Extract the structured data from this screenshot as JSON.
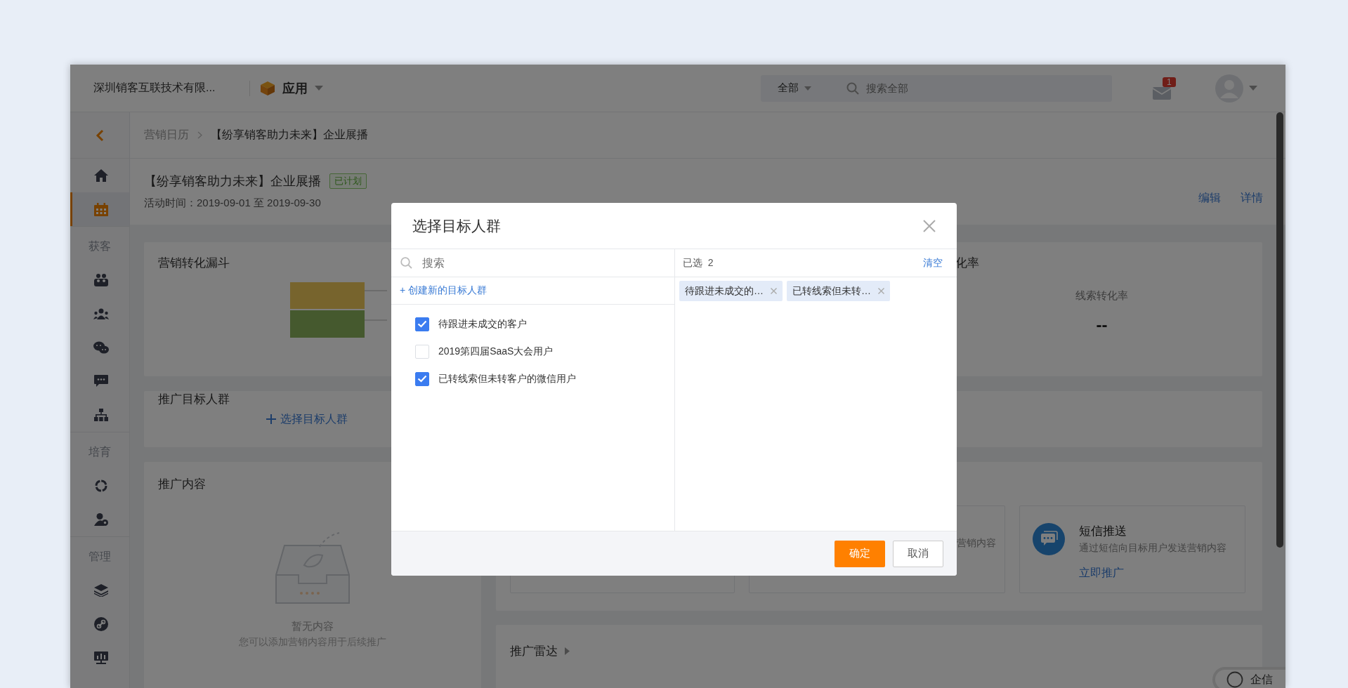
{
  "topbar": {
    "company": "深圳销客互联技术有限...",
    "app_menu": "应用",
    "scope": "全部",
    "search": {
      "placeholder": "搜索全部"
    },
    "mail_badge": "1"
  },
  "sidebar": {
    "groups": [
      {
        "items": [
          {
            "kind": "home",
            "selected": false
          },
          {
            "kind": "calendar",
            "selected": true
          }
        ]
      },
      {
        "label": "获客",
        "items": [
          {
            "kind": "group",
            "selected": false
          },
          {
            "kind": "team",
            "selected": false
          },
          {
            "kind": "chat",
            "selected": false
          },
          {
            "kind": "message",
            "selected": false
          },
          {
            "kind": "org",
            "selected": false
          }
        ]
      },
      {
        "label": "培育",
        "items": [
          {
            "kind": "cycle",
            "selected": false
          },
          {
            "kind": "user",
            "selected": false
          }
        ]
      },
      {
        "label": "管理",
        "items": [
          {
            "kind": "layers",
            "selected": false
          },
          {
            "kind": "link",
            "selected": false
          },
          {
            "kind": "board",
            "selected": false
          }
        ]
      }
    ]
  },
  "breadcrumb": [
    "营销日历",
    "【纷享销客助力未来】企业展播"
  ],
  "activity": {
    "title": "【纷享销客助力未来】企业展播",
    "status": "已计划",
    "time": "活动时间：2019-09-01 至 2019-09-30",
    "actions": [
      "编辑",
      "详情"
    ]
  },
  "funnel_card": {
    "title": "营销转化漏斗"
  },
  "rate_card": {
    "title": "化率",
    "metric_label": "线索转化率",
    "metric_value": "--"
  },
  "audience_card": {
    "title": "推广目标人群",
    "action": "选择目标人群"
  },
  "content_card": {
    "title": "推广内容",
    "empty_title": "暂无内容",
    "empty_desc": "您可以添加营销内容用于后续推广"
  },
  "channels": [
    {
      "kind": "partial",
      "description": "营销内容"
    },
    {
      "kind": "sms",
      "title": "短信推送",
      "description": "通过短信向目标用户发送营销内容",
      "action": "立即推广"
    }
  ],
  "radar": {
    "title": "推广雷达"
  },
  "chat_button": {
    "label": "企信"
  },
  "modal": {
    "title": "选择目标人群",
    "search": {
      "placeholder": "搜索"
    },
    "create_link": "+ 创建新的目标人群",
    "options": [
      {
        "label": "待跟进未成交的客户",
        "checked": true
      },
      {
        "label": "2019第四届SaaS大会用户",
        "checked": false
      },
      {
        "label": "已转线索但未转客户的微信用户",
        "checked": true
      }
    ],
    "selected_label": "已选",
    "selected_count": "2",
    "clear": "清空",
    "tags": [
      "待跟进未成交的…",
      "已转线索但未转…"
    ],
    "buttons": [
      {
        "kind": "primary",
        "label": "确定"
      },
      {
        "kind": "default",
        "label": "取消"
      }
    ]
  }
}
